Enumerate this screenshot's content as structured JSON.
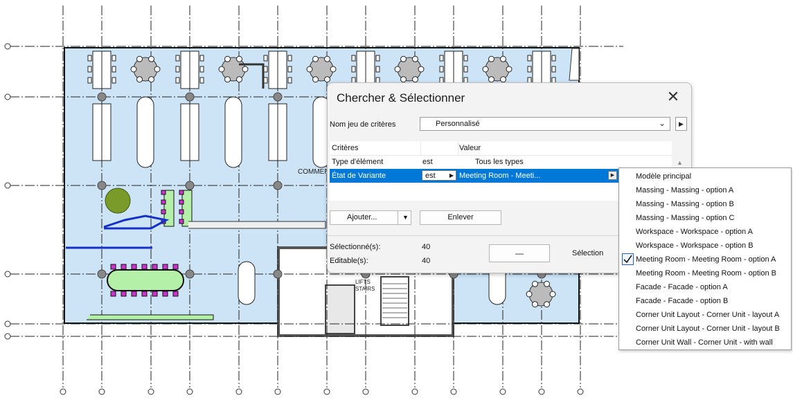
{
  "plan": {
    "labels": [
      "COMMER",
      "LIFTS",
      "STAIRS"
    ]
  },
  "dialog": {
    "title": "Chercher & Sélectionner",
    "close_icon": "close-icon",
    "criteria_set_label": "Nom jeu de critères",
    "criteria_set_colon": ":",
    "criteria_set_value": "Personnalisé",
    "grid": {
      "headers": [
        "Critères",
        "Valeur"
      ],
      "rows": [
        {
          "criteria": "Type d'élément",
          "operator": "est",
          "value": "Tous les types"
        },
        {
          "criteria": "État de Variante",
          "operator": "est",
          "value": "Meeting Room - Meeti..."
        }
      ]
    },
    "buttons": {
      "add": "Ajouter...",
      "remove": "Enlever",
      "selection_placeholder": "—"
    },
    "stats": {
      "selected_label": "Sélectionné(s):",
      "selected_value": "40",
      "editable_label": "Editable(s):",
      "editable_value": "40",
      "selection_label": "Sélection"
    }
  },
  "dropdown": {
    "items": [
      {
        "label": "Modèle principal",
        "checked": false
      },
      {
        "label": "Massing - Massing - option A",
        "checked": false
      },
      {
        "label": "Massing - Massing - option B",
        "checked": false
      },
      {
        "label": "Massing - Massing - option C",
        "checked": false
      },
      {
        "label": "Workspace - Workspace - option A",
        "checked": false
      },
      {
        "label": "Workspace - Workspace - option B",
        "checked": false
      },
      {
        "label": "Meeting Room - Meeting Room - option A",
        "checked": true
      },
      {
        "label": "Meeting Room - Meeting Room - option B",
        "checked": false
      },
      {
        "label": "Facade - Facade - option A",
        "checked": false
      },
      {
        "label": "Facade - Facade - option B",
        "checked": false
      },
      {
        "label": "Corner Unit Layout - Corner Unit - layout A",
        "checked": false
      },
      {
        "label": "Corner Unit Layout - Corner Unit - layout B",
        "checked": false
      },
      {
        "label": "Corner Unit Wall - Corner Unit - with wall",
        "checked": false
      }
    ]
  },
  "colors": {
    "floor_fill": "#cde4f7",
    "selection_blue": "#0078d7",
    "highlight_magenta": "#cc33cc",
    "highlight_green": "#b5f0a8"
  }
}
